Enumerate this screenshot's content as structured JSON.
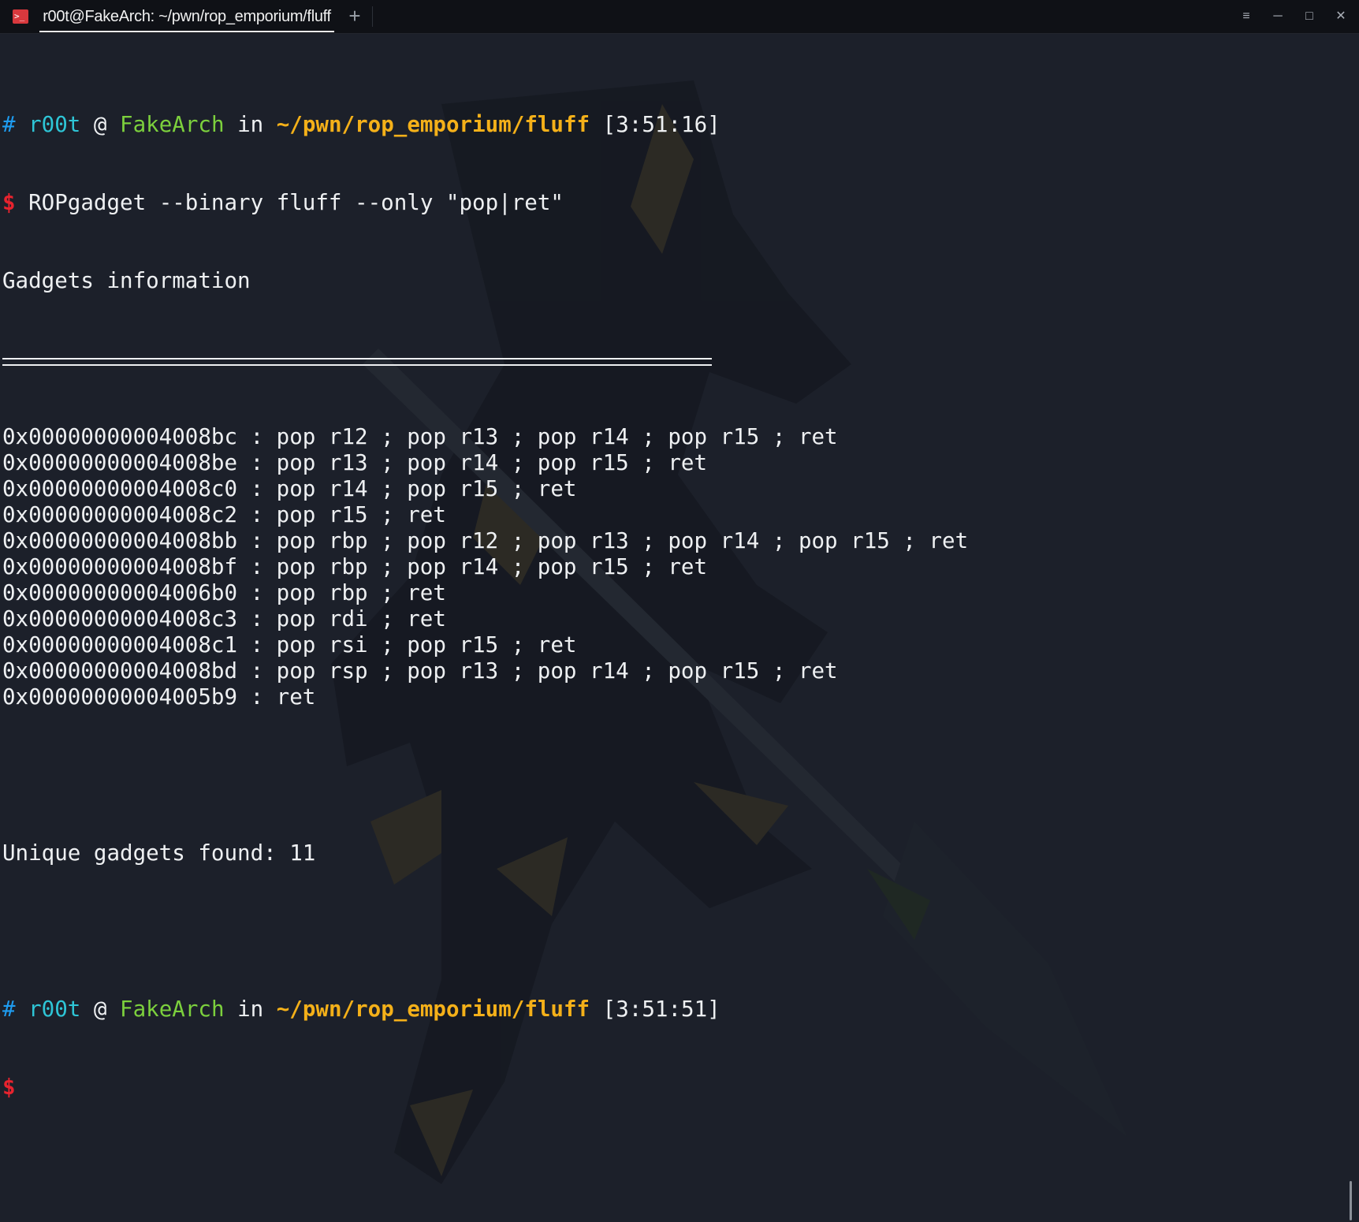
{
  "window": {
    "tab_title": "r00t@FakeArch: ~/pwn/rop_emporium/fluff",
    "new_tab_label": "+",
    "menu_label": "≡",
    "minimize_label": "─",
    "maximize_label": "□",
    "close_label": "✕",
    "app_icon_glyph": ">_"
  },
  "colors": {
    "background": "#1c202a",
    "hash": "#1e9cf0",
    "user": "#2ec5d6",
    "host": "#7cd03d",
    "path": "#f4b019",
    "dollar": "#e8232e",
    "text": "#eef0f2"
  },
  "prompt1": {
    "hash": "#",
    "user": "r00t",
    "at": "@",
    "host": "FakeArch",
    "in": "in",
    "path": "~/pwn/rop_emporium/fluff",
    "time": "[3:51:16]",
    "dollar": "$",
    "command": "ROPgadget --binary fluff --only \"pop|ret\""
  },
  "output": {
    "header": "Gadgets information",
    "gadgets": [
      "0x00000000004008bc : pop r12 ; pop r13 ; pop r14 ; pop r15 ; ret",
      "0x00000000004008be : pop r13 ; pop r14 ; pop r15 ; ret",
      "0x00000000004008c0 : pop r14 ; pop r15 ; ret",
      "0x00000000004008c2 : pop r15 ; ret",
      "0x00000000004008bb : pop rbp ; pop r12 ; pop r13 ; pop r14 ; pop r15 ; ret",
      "0x00000000004008bf : pop rbp ; pop r14 ; pop r15 ; ret",
      "0x00000000004006b0 : pop rbp ; ret",
      "0x00000000004008c3 : pop rdi ; ret",
      "0x00000000004008c1 : pop rsi ; pop r15 ; ret",
      "0x00000000004008bd : pop rsp ; pop r13 ; pop r14 ; pop r15 ; ret",
      "0x00000000004005b9 : ret"
    ],
    "summary": "Unique gadgets found: 11"
  },
  "prompt2": {
    "hash": "#",
    "user": "r00t",
    "at": "@",
    "host": "FakeArch",
    "in": "in",
    "path": "~/pwn/rop_emporium/fluff",
    "time": "[3:51:51]",
    "dollar": "$"
  }
}
